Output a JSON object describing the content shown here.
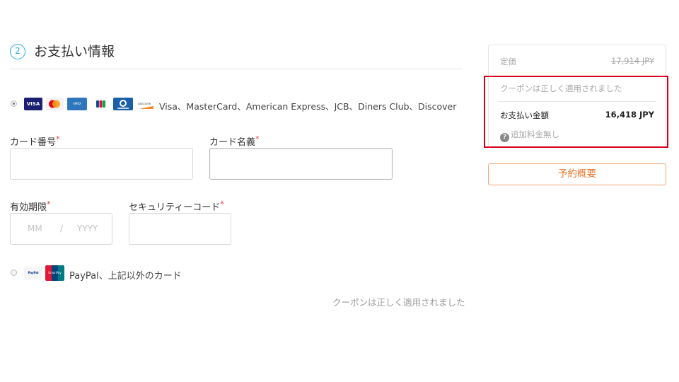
{
  "payment": {
    "step_number": "2",
    "title": "お支払い情報",
    "card_option": {
      "selected": true,
      "logos": [
        "VISA",
        "MasterCard",
        "AMEX",
        "JCB",
        "Diners",
        "DISCOVER"
      ],
      "label": "Visa、MasterCard、American Express、JCB、Diners Club、Discover"
    },
    "fields": {
      "card_number": {
        "label": "カード番号",
        "value": ""
      },
      "card_name": {
        "label": "カード名義",
        "value": ""
      },
      "expiry": {
        "label": "有効期限",
        "month_placeholder": "MM",
        "separator": "/",
        "year_placeholder": "YYYY"
      },
      "security_code": {
        "label": "セキュリティーコード",
        "value": ""
      },
      "required_mark": "*"
    },
    "paypal_option": {
      "selected": false,
      "logos": [
        "PayPal",
        "UnionPay"
      ],
      "label": "PayPal、上記以外のカード"
    },
    "coupon_message": "クーポンは正しく適用されました"
  },
  "summary": {
    "list_price_label": "定価",
    "list_price_value": "17,914 JPY",
    "coupon_message": "クーポンは正しく適用されました",
    "total_label": "お支払い金額",
    "total_value": "16,418 JPY",
    "extra_fee_label": "追加料金無し",
    "help_icon": "?"
  },
  "buttons": {
    "overview": "予約概要"
  },
  "colors": {
    "accent_blue": "#2aa9e0",
    "button_orange": "#e8752c",
    "highlight_red": "#d6001c",
    "required_red": "#e53935"
  }
}
